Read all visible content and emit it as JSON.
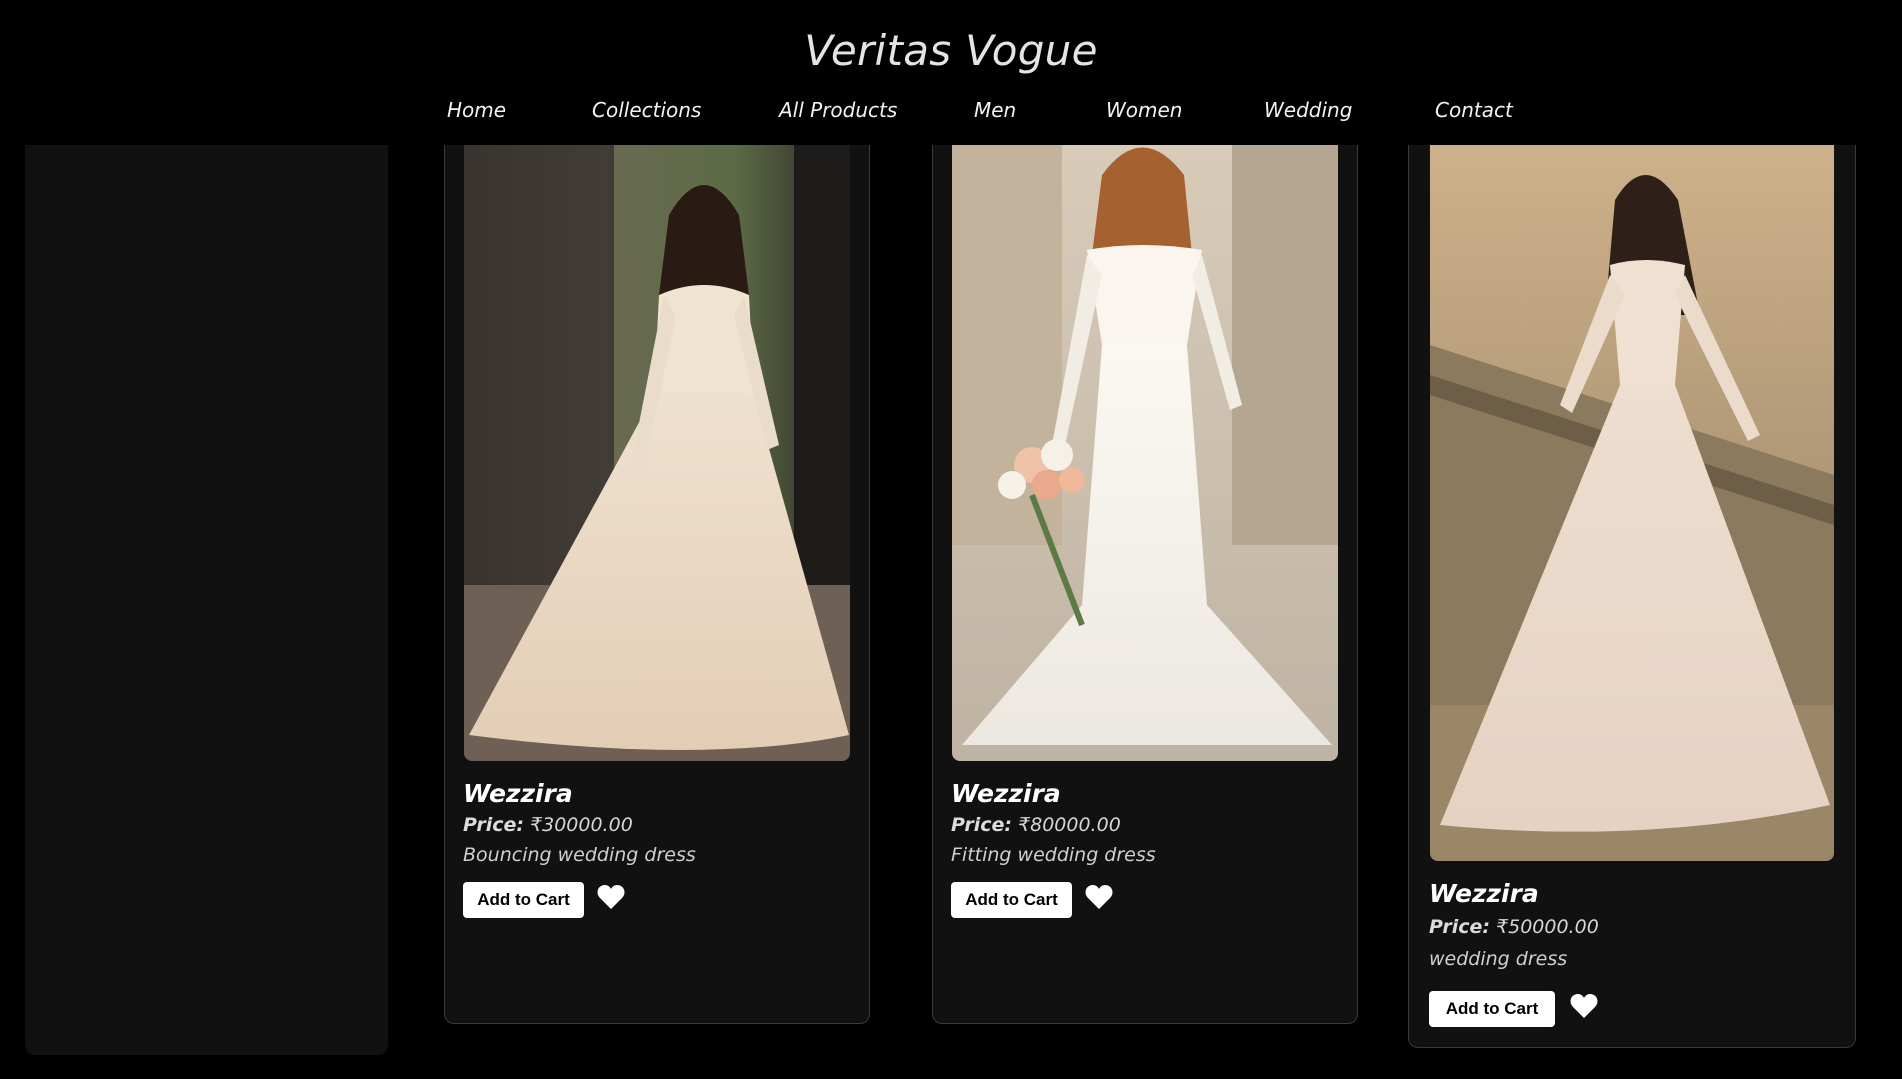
{
  "site": {
    "title": "Veritas Vogue"
  },
  "nav": {
    "items": [
      {
        "label": "Home"
      },
      {
        "label": "Collections"
      },
      {
        "label": "All Products"
      },
      {
        "label": "Men"
      },
      {
        "label": "Women"
      },
      {
        "label": "Wedding"
      },
      {
        "label": "Contact"
      }
    ]
  },
  "products": [
    {
      "name": "Wezzira",
      "price_label": "Price:",
      "price": "₹30000.00",
      "description": "Bouncing wedding dress",
      "cart_label": "Add to Cart",
      "wishlist_icon": "heart-icon"
    },
    {
      "name": "Wezzira",
      "price_label": "Price:",
      "price": "₹80000.00",
      "description": "Fitting wedding dress",
      "cart_label": "Add to Cart",
      "wishlist_icon": "heart-icon"
    },
    {
      "name": "Wezzira",
      "price_label": "Price:",
      "price": "₹50000.00",
      "description": "wedding dress",
      "cart_label": "Add to Cart",
      "wishlist_icon": "heart-icon"
    }
  ],
  "colors": {
    "background": "#000000",
    "panel": "#111111",
    "button": "#ffffff"
  }
}
